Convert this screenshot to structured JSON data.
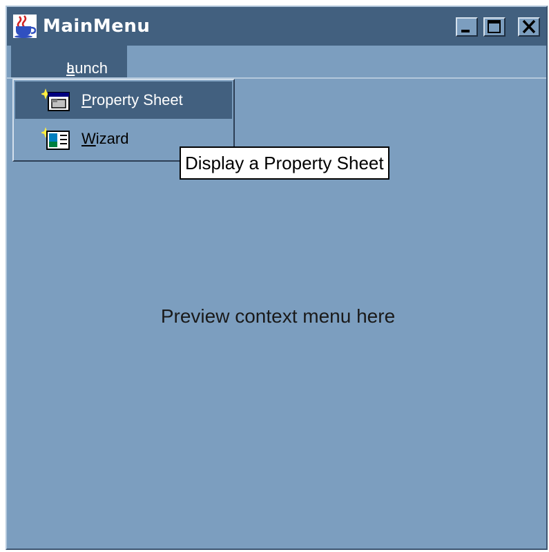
{
  "window": {
    "title": "MainMenu",
    "icon": "java-cup-icon",
    "controls": [
      "minimize-icon",
      "maximize-icon",
      "close-icon"
    ]
  },
  "menubar": {
    "launch": {
      "mnemonic": "L",
      "rest": "aunch"
    }
  },
  "launch_menu": {
    "items": [
      {
        "mnemonic": "P",
        "rest": "roperty  Sheet",
        "icon": "property-sheet-icon",
        "selected": true
      },
      {
        "mnemonic": "W",
        "rest": "izard",
        "icon": "wizard-icon",
        "selected": false
      }
    ]
  },
  "tooltip": {
    "text": "Display a Property Sheet"
  },
  "content": {
    "preview_text": "Preview context menu here"
  },
  "colors": {
    "window_bg": "#7c9ebf",
    "titlebar_bg": "#42607f",
    "selection_bg": "#42607f"
  }
}
